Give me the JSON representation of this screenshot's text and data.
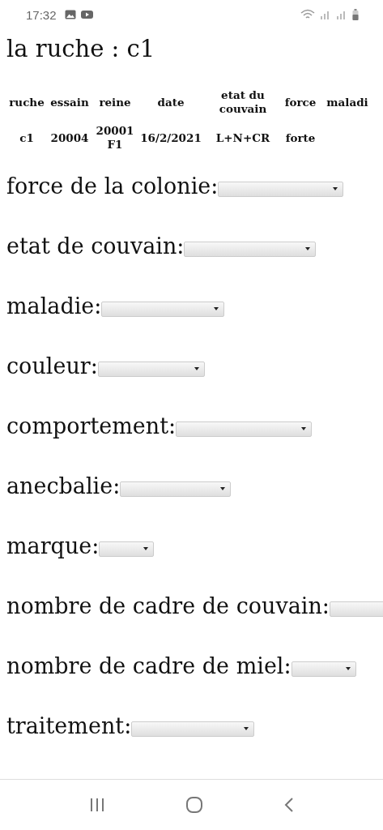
{
  "status_bar": {
    "time": "17:32"
  },
  "title": "la ruche : c1",
  "table": {
    "columns": [
      "ruche",
      "essain",
      "reine",
      "date",
      "etat du couvain",
      "force",
      "maladi"
    ],
    "rows": [
      [
        "c1",
        "20004",
        "20001 F1",
        "16/2/2021",
        "L+N+CR",
        "forte"
      ]
    ]
  },
  "fields": [
    {
      "label": "force de la colonie:"
    },
    {
      "label": "etat de couvain:"
    },
    {
      "label": "maladie:"
    },
    {
      "label": "couleur:"
    },
    {
      "label": "comportement:"
    },
    {
      "label": "anecbalie:"
    },
    {
      "label": "marque:"
    },
    {
      "label": "nombre de cadre de couvain:"
    },
    {
      "label": "nombre de cadre de miel:"
    },
    {
      "label": "traitement:"
    }
  ]
}
